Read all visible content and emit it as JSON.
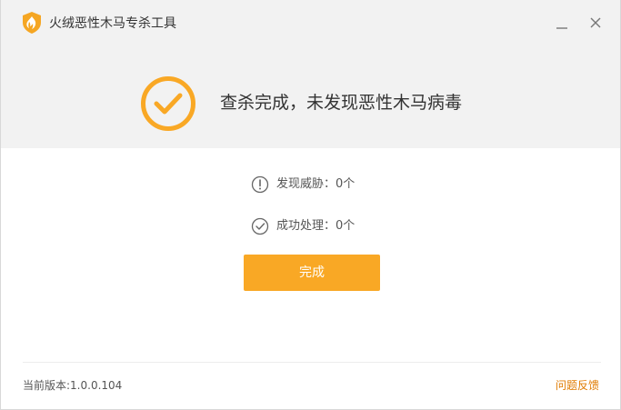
{
  "window": {
    "title": "火绒恶性木马专杀工具",
    "logo_icon": "huorong-flame-icon",
    "minimize_icon": "minimize-icon",
    "close_icon": "close-icon"
  },
  "result": {
    "icon": "check-circle-icon",
    "message": "查杀完成，未发现恶性木马病毒"
  },
  "stats": {
    "threats_label": "发现威胁：0个",
    "threats_icon": "warning-circle-icon",
    "handled_label": "成功处理：0个",
    "handled_icon": "check-circle-outline-icon"
  },
  "actions": {
    "done_label": "完成"
  },
  "footer": {
    "version": "当前版本:1.0.0.104",
    "feedback": "问题反馈"
  },
  "colors": {
    "accent": "#f9a825",
    "header_bg": "#f2f2f2",
    "link": "#e07b00"
  }
}
